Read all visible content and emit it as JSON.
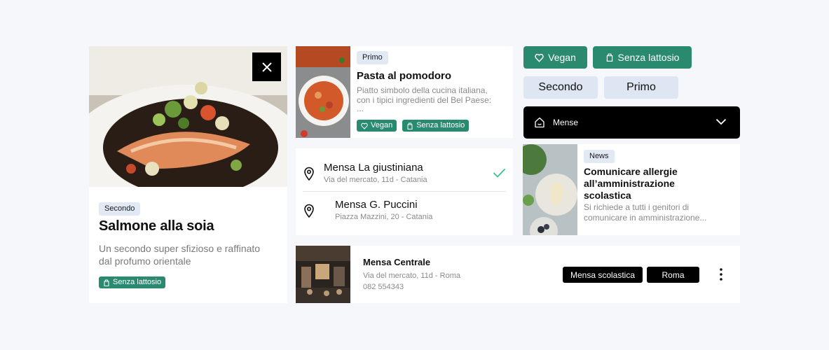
{
  "card_main": {
    "tag": "Secondo",
    "title": "Salmone alla soia",
    "description_line1": "Un secondo super sfizioso e raffinato",
    "description_line2": "dal profumo orientale",
    "badge": "Senza lattosio",
    "close_icon": "close-icon"
  },
  "card_pasta": {
    "tag": "Primo",
    "title": "Pasta al pomodoro",
    "description_line1": "Piatto simbolo della cucina italiana,",
    "description_line2": "con i tipici ingredienti del Bel Paese:",
    "description_line3": "...",
    "badge_vegan": "Vegan",
    "badge_lactose": "Senza lattosio"
  },
  "location_list": {
    "items": [
      {
        "name": "Mensa La giustiniana",
        "address": "Via del mercato, 11d - Catania",
        "selected": true
      },
      {
        "name": "Mensa G. Puccini",
        "address": "Piazza Mazzini, 20 - Catania",
        "selected": false
      }
    ]
  },
  "filters": {
    "vegan": "Vegan",
    "lactose_free": "Senza lattosio",
    "secondo": "Secondo",
    "primo": "Primo"
  },
  "dropdown": {
    "label": "Mense"
  },
  "news_card": {
    "tag": "News",
    "title_line1": "Comunicare allergie",
    "title_line2": "all’amministrazione",
    "title_line3": "scolastica",
    "description_line1": "Si richiede a tutti i genitori di",
    "description_line2": "comunicare in amministrazione..."
  },
  "canteen_card": {
    "name": "Mensa Centrale",
    "address": "Via del mercato, 11d - Roma",
    "phone": "082 554343",
    "tag_type": "Mensa scolastica",
    "tag_city": "Roma"
  },
  "colors": {
    "accent_green": "#2a8a70",
    "tag_blue": "#e1e9f5",
    "check_green": "#3cc28f"
  }
}
